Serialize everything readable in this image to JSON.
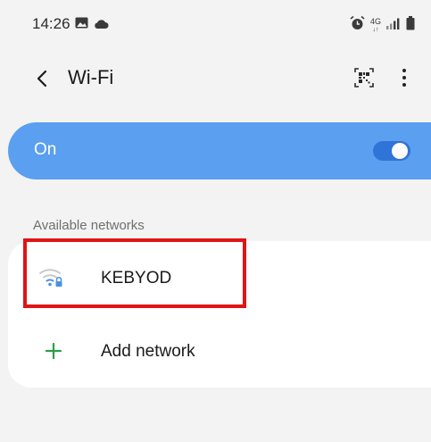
{
  "status_bar": {
    "time": "14:26",
    "network_type": "4G",
    "icons": [
      "gallery-icon",
      "cloud-icon",
      "alarm-icon",
      "signal-icon",
      "battery-icon"
    ]
  },
  "header": {
    "title": "Wi-Fi",
    "back_icon": "chevron-left-icon",
    "qr_icon": "qr-code-icon",
    "more_icon": "more-vert-icon"
  },
  "master_switch": {
    "label": "On",
    "state": true
  },
  "networks": {
    "section_label": "Available networks",
    "items": [
      {
        "name": "KEBYOD",
        "icon": "wifi-locked-icon"
      }
    ],
    "add_label": "Add network"
  },
  "colors": {
    "background": "#f3f3f3",
    "accent_bar": "#5b9ff0",
    "toggle_on": "#2f74d6",
    "add_plus": "#2e9d4a",
    "highlight": "#e01414"
  }
}
